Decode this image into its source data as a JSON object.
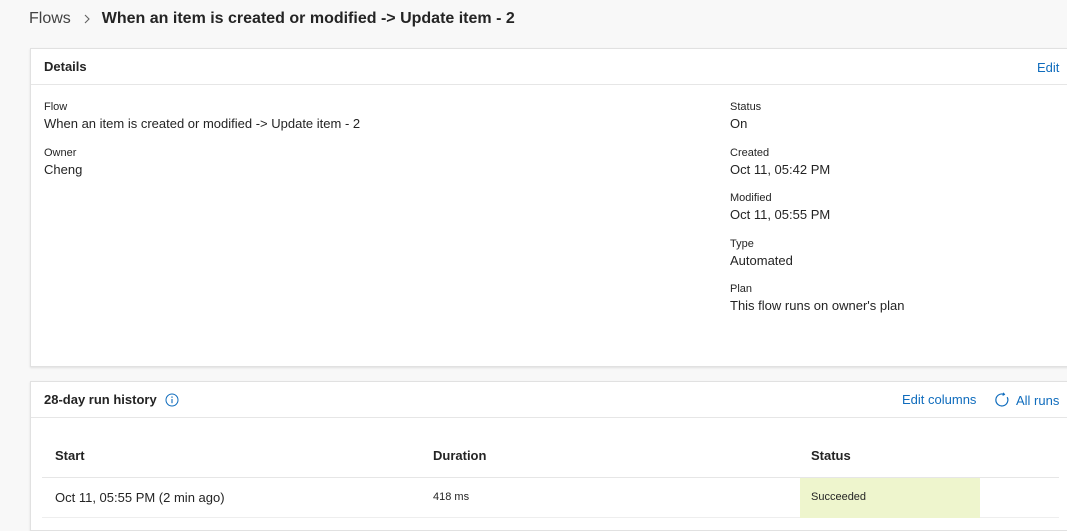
{
  "breadcrumb": {
    "root": "Flows",
    "current": "When an item is created or modified -> Update item - 2"
  },
  "details": {
    "title": "Details",
    "edit_label": "Edit",
    "flow": {
      "label": "Flow",
      "value": "When an item is created or modified -> Update item - 2"
    },
    "owner": {
      "label": "Owner",
      "value": "Cheng"
    },
    "status": {
      "label": "Status",
      "value": "On"
    },
    "created": {
      "label": "Created",
      "value": "Oct 11, 05:42 PM"
    },
    "modified": {
      "label": "Modified",
      "value": "Oct 11, 05:55 PM"
    },
    "type": {
      "label": "Type",
      "value": "Automated"
    },
    "plan": {
      "label": "Plan",
      "value": "This flow runs on owner's plan"
    }
  },
  "run_history": {
    "title": "28-day run history",
    "edit_columns_label": "Edit columns",
    "all_runs_label": "All runs",
    "columns": [
      "Start",
      "Duration",
      "Status"
    ],
    "rows": [
      {
        "start": "Oct 11, 05:55 PM (2 min ago)",
        "duration": "418 ms",
        "status": "Succeeded"
      }
    ]
  },
  "colors": {
    "link": "#0f6cbd",
    "success_bg": "#eef5cd"
  }
}
